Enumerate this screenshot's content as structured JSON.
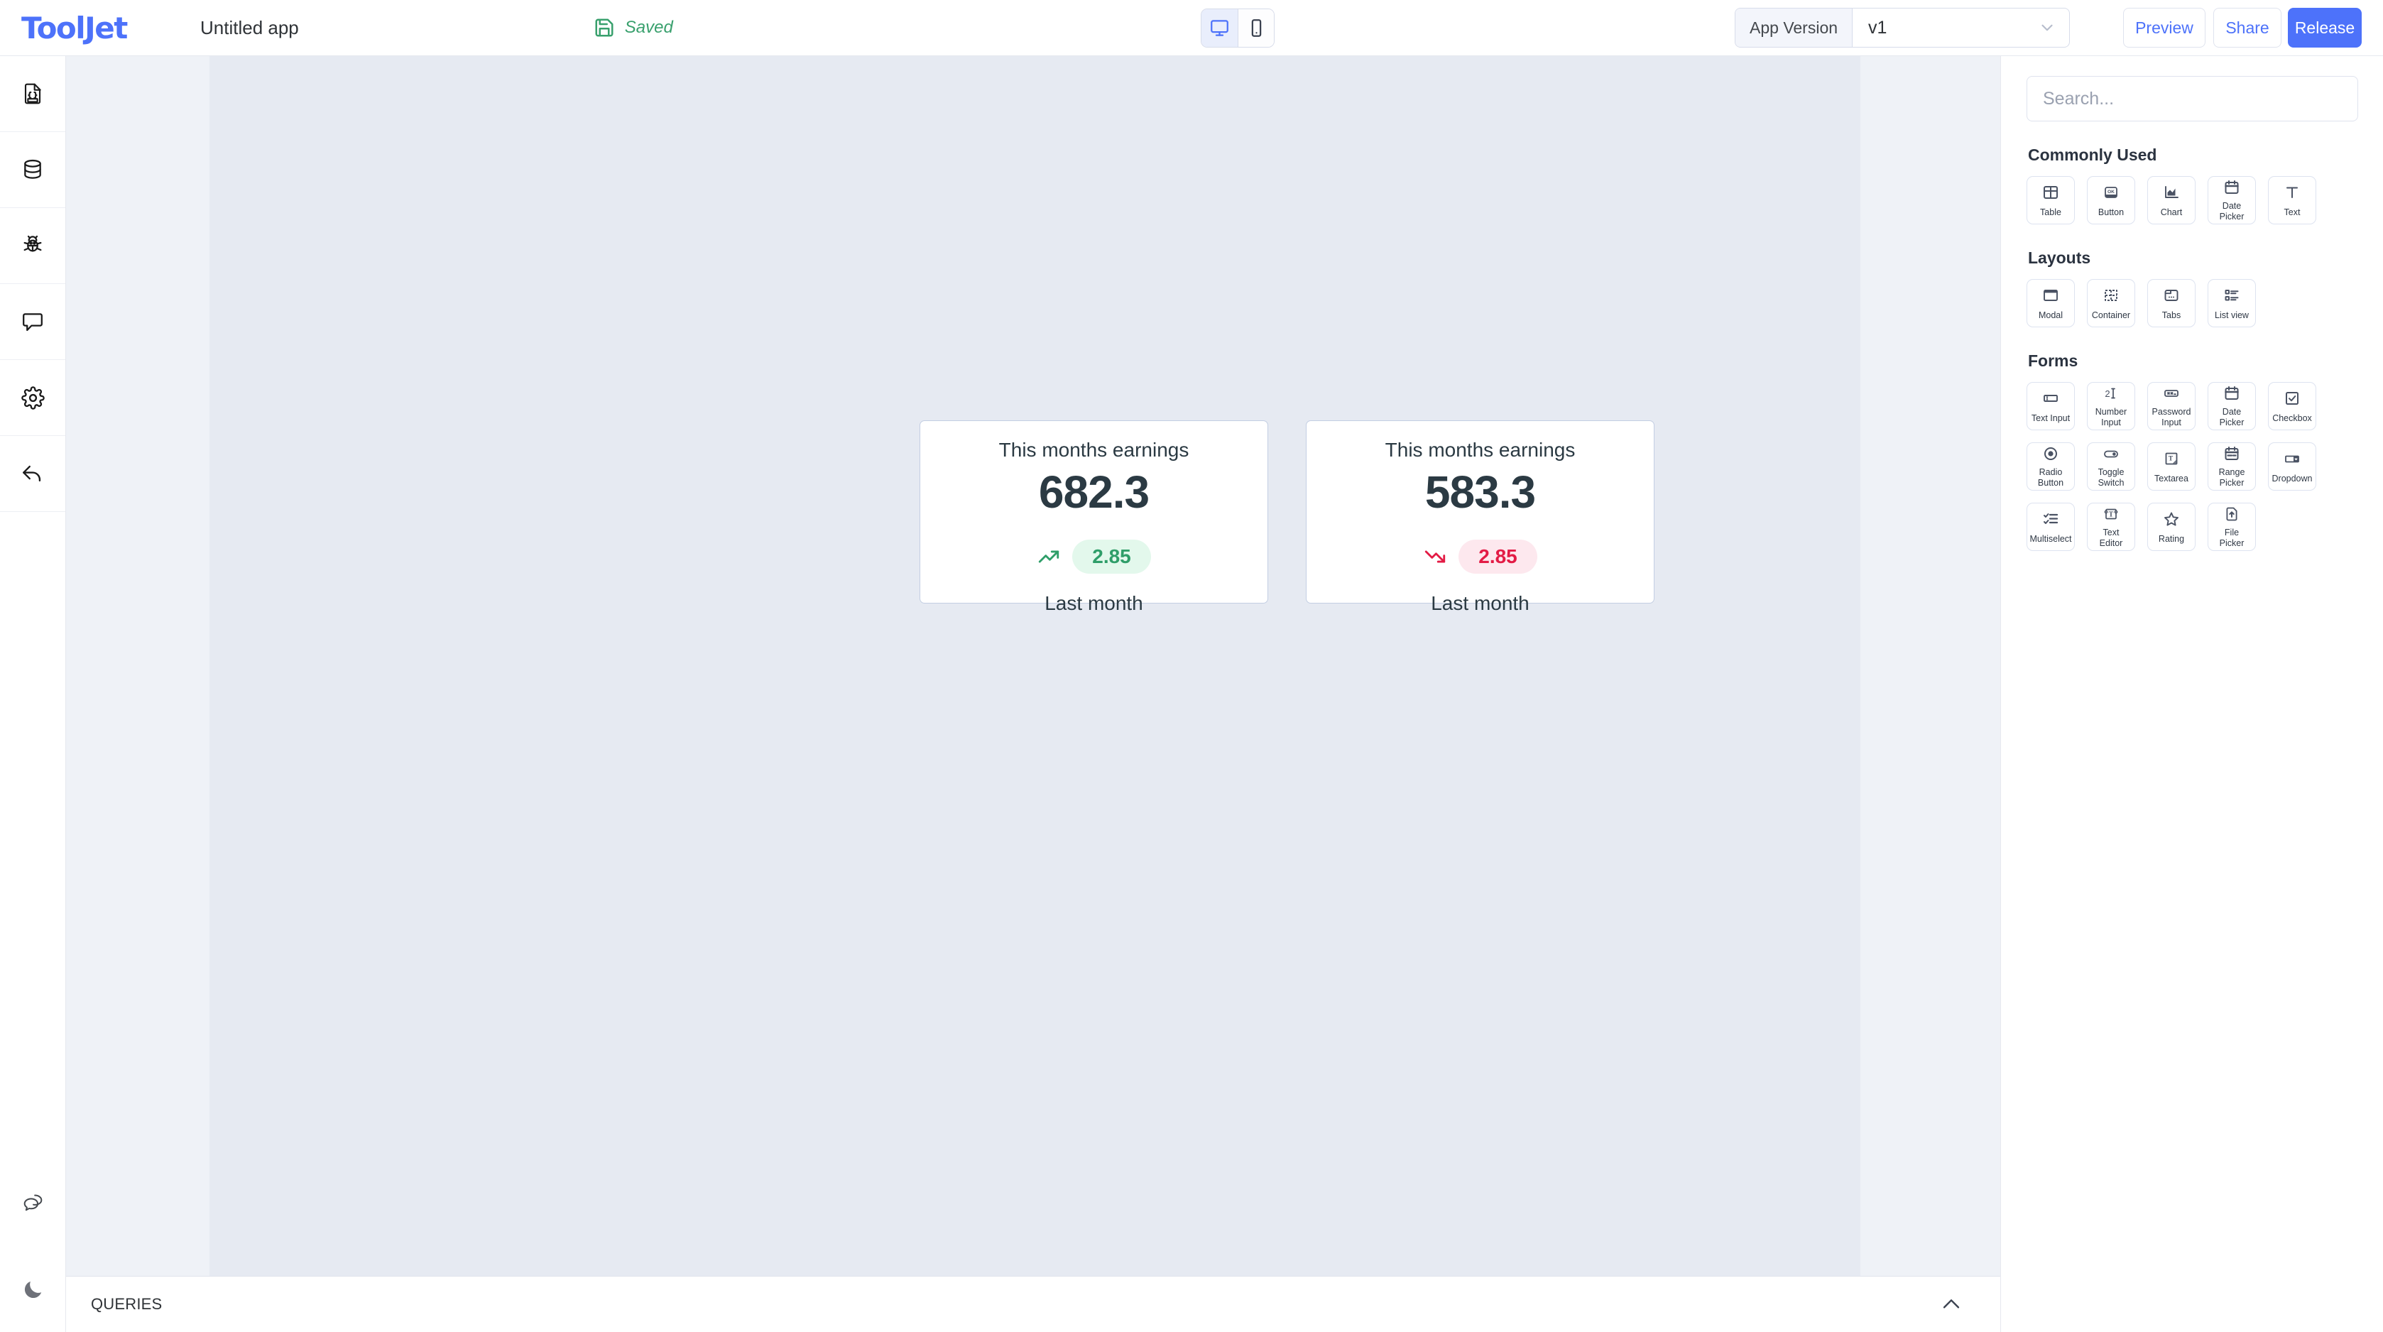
{
  "header": {
    "logo": "ToolJet",
    "app_title": "Untitled app",
    "save_status": "Saved",
    "save_icon": "save-disk-icon",
    "device_desktop_icon": "desktop-monitor-icon",
    "device_mobile_icon": "mobile-phone-icon",
    "active_device": "desktop",
    "version_label": "App Version",
    "version_value": "v1",
    "version_chevron_icon": "chevron-down-icon",
    "preview_label": "Preview",
    "share_label": "Share",
    "release_label": "Release",
    "accent_color": "#4d72fa",
    "saved_color": "#39a06d"
  },
  "sidebar": {
    "items": [
      {
        "name": "json-file-icon",
        "title": "Inspector"
      },
      {
        "name": "database-icon",
        "title": "Data sources"
      },
      {
        "name": "bug-icon",
        "title": "Debugger"
      },
      {
        "name": "comment-icon",
        "title": "Comments"
      },
      {
        "name": "gear-icon",
        "title": "Settings"
      },
      {
        "name": "undo-arrow-icon",
        "title": "Undo"
      }
    ],
    "bottom_items": [
      {
        "name": "chat-bubbles-icon",
        "title": "Support"
      },
      {
        "name": "moon-icon",
        "title": "Dark mode"
      }
    ]
  },
  "canvas": {
    "widgets": [
      {
        "title": "This months earnings",
        "value": "682.3",
        "trend": "up",
        "trend_icon": "trending-up-icon",
        "change": "2.85",
        "footer": "Last month",
        "pill_bg": "#e3f8ec",
        "pill_color": "#2f9e69"
      },
      {
        "title": "This months earnings",
        "value": "583.3",
        "trend": "down",
        "trend_icon": "trending-down-icon",
        "change": "2.85",
        "footer": "Last month",
        "pill_bg": "#fde8ee",
        "pill_color": "#e31b45"
      }
    ]
  },
  "queries": {
    "label": "QUERIES",
    "collapse_icon": "chevron-up-icon"
  },
  "components_panel": {
    "search_placeholder": "Search...",
    "search_value": "",
    "sections": [
      {
        "title": "Commonly Used",
        "items": [
          {
            "label": "Table",
            "icon": "table-grid-icon"
          },
          {
            "label": "Button",
            "icon": "ok-button-icon"
          },
          {
            "label": "Chart",
            "icon": "chart-area-icon"
          },
          {
            "label": "Date Picker",
            "icon": "calendar-icon"
          },
          {
            "label": "Text",
            "icon": "text-t-icon"
          }
        ]
      },
      {
        "title": "Layouts",
        "items": [
          {
            "label": "Modal",
            "icon": "modal-window-icon"
          },
          {
            "label": "Container",
            "icon": "container-dashed-icon"
          },
          {
            "label": "Tabs",
            "icon": "tabs-icon"
          },
          {
            "label": "List view",
            "icon": "list-view-icon"
          }
        ]
      },
      {
        "title": "Forms",
        "items": [
          {
            "label": "Text Input",
            "icon": "text-input-icon"
          },
          {
            "label": "Number Input",
            "icon": "number-input-icon"
          },
          {
            "label": "Password Input",
            "icon": "password-input-icon"
          },
          {
            "label": "Date Picker",
            "icon": "calendar-icon"
          },
          {
            "label": "Checkbox",
            "icon": "checkbox-icon"
          },
          {
            "label": "Radio Button",
            "icon": "radio-button-icon"
          },
          {
            "label": "Toggle Switch",
            "icon": "toggle-switch-icon"
          },
          {
            "label": "Textarea",
            "icon": "textarea-icon"
          },
          {
            "label": "Range Picker",
            "icon": "range-picker-icon"
          },
          {
            "label": "Dropdown",
            "icon": "dropdown-icon"
          },
          {
            "label": "Multiselect",
            "icon": "multiselect-icon"
          },
          {
            "label": "Text Editor",
            "icon": "text-editor-icon"
          },
          {
            "label": "Rating",
            "icon": "star-icon"
          },
          {
            "label": "File Picker",
            "icon": "file-upload-icon"
          }
        ]
      }
    ]
  }
}
